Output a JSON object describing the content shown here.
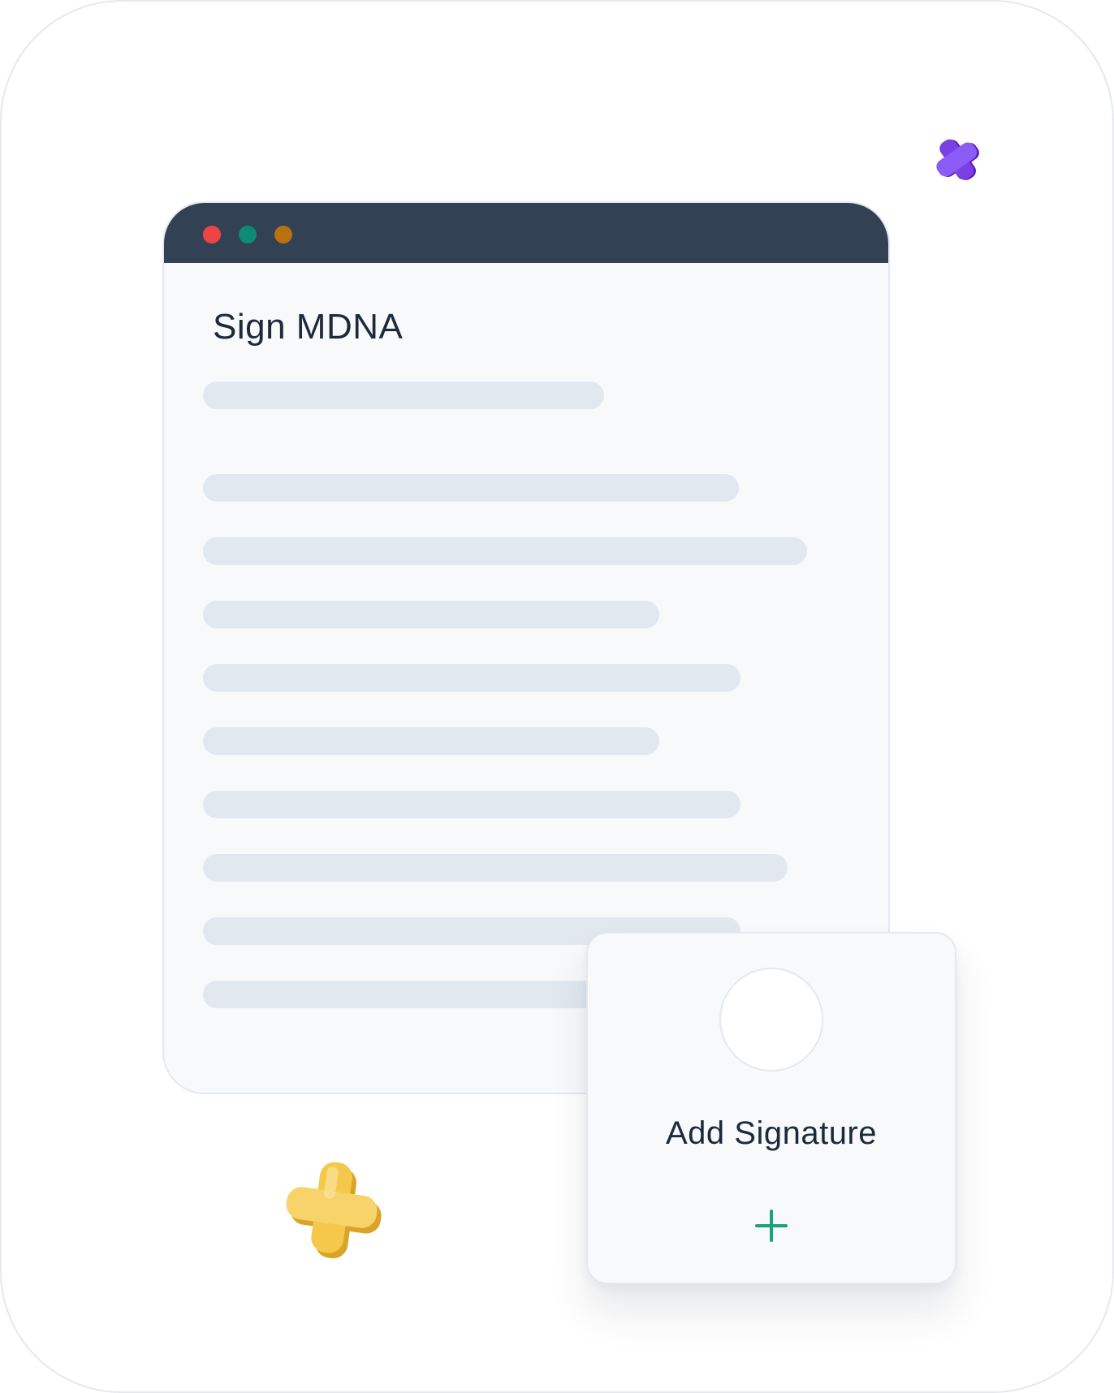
{
  "window": {
    "controls": [
      {
        "name": "close",
        "color": "#ef4444"
      },
      {
        "name": "minimize",
        "color": "#0f8a74"
      },
      {
        "name": "maximize",
        "color": "#b9700e"
      }
    ],
    "title": "Sign MDNA"
  },
  "signature_card": {
    "label": "Add Signature",
    "add_icon": "plus-icon",
    "add_color": "#1aa37a"
  },
  "decorations": {
    "purple_cross_color": "#7b3fe4",
    "yellow_plus_color": "#f5c84c"
  }
}
